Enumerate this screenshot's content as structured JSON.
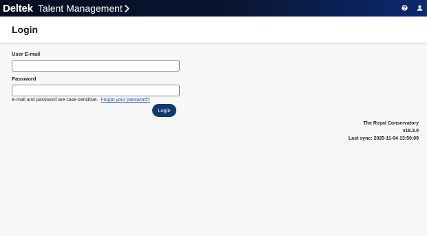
{
  "topbar": {
    "logo": "Deltek",
    "product": "Talent Management",
    "chevron_icon": "chevron-right-icon",
    "help_icon": "question-circle-icon",
    "user_icon": "user-icon",
    "gradient_start": "#060d1f",
    "gradient_end": "#0b2a73"
  },
  "page": {
    "title": "Login"
  },
  "form": {
    "email_label": "User E-mail",
    "email_value": "",
    "password_label": "Password",
    "password_value": "",
    "hint_text": "E-mail and password are case sensitive.",
    "forgot_link": "Forgot your password?",
    "login_button": "Login",
    "button_color": "#0e3a6e"
  },
  "footer": {
    "organization": "The Royal Conservatory",
    "version": "v18.3.0",
    "last_sync": "Last sync: 2025-11-04 13:50:09"
  }
}
